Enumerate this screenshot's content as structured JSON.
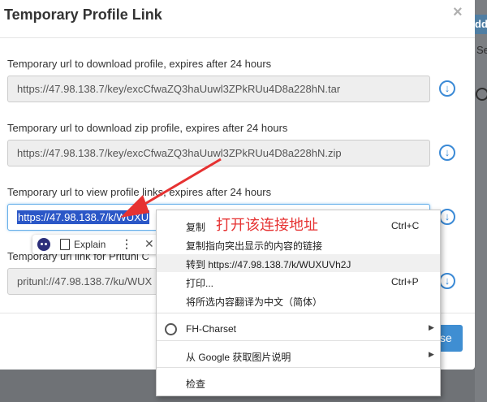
{
  "background": {
    "add_button_label": "dd",
    "fragment_text": "Se"
  },
  "modal": {
    "title": "Temporary Profile Link",
    "close_symbol": "×",
    "fields": [
      {
        "label": "Temporary url to download profile, expires after 24 hours",
        "value": "https://47.98.138.7/key/excCfwaZQ3haUuwl3ZPkRUu4D8a228hN.tar"
      },
      {
        "label": "Temporary url to download zip profile, expires after 24 hours",
        "value": "https://47.98.138.7/key/excCfwaZQ3haUuwl3ZPkRUu4D8a228hN.zip"
      },
      {
        "label": "Temporary url to view profile links, expires after 24 hours",
        "value": "https://47.98.138.7/k/WUXU"
      },
      {
        "label": "Temporary uri link for Pritunl C",
        "value": "pritunl://47.98.138.7/ku/WUX"
      }
    ],
    "close_button_label": "se"
  },
  "extension_toolbar": {
    "explain_label": "Explain",
    "more_symbol": "⋮",
    "close_symbol": "✕"
  },
  "context_menu": {
    "items": [
      {
        "label": "复制",
        "shortcut": "Ctrl+C"
      },
      {
        "label": "复制指向突出显示的内容的链接"
      },
      {
        "label": "转到 https://47.98.138.7/k/WUXUVh2J"
      },
      {
        "label": "打印...",
        "shortcut": "Ctrl+P"
      },
      {
        "label": "将所选内容翻译为中文（简体）"
      },
      {
        "label": "FH-Charset"
      },
      {
        "label": "从 Google 获取图片说明"
      },
      {
        "label": "检查"
      }
    ],
    "submenu_arrow": "▶"
  },
  "annotation": {
    "text": "打开该连接地址",
    "color": "#e63232"
  },
  "colors": {
    "accent": "#3f8ed2",
    "selection": "#2b57c7",
    "overlay": "#6f7276"
  }
}
